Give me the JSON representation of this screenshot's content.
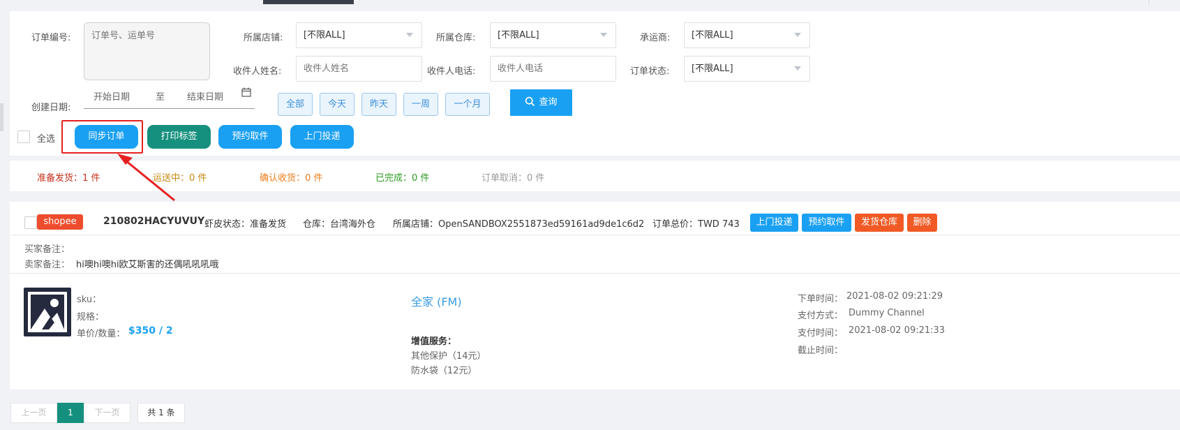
{
  "search": {
    "order_no_label": "订单编号:",
    "order_no_placeholder": "订单号、运单号",
    "shop_label": "所属店铺:",
    "shop_value": "[不限ALL]",
    "warehouse_label": "所属仓库:",
    "warehouse_value": "[不限ALL]",
    "carrier_label": "承运商:",
    "carrier_value": "[不限ALL]",
    "receiver_name_label": "收件人姓名:",
    "receiver_name_placeholder": "收件人姓名",
    "receiver_phone_label": "收件人电话:",
    "receiver_phone_placeholder": "收件人电话",
    "status_label": "订单状态:",
    "status_value": "[不限ALL]",
    "date_label": "创建日期:",
    "start_date": "开始日期",
    "to": "至",
    "end_date": "结束日期",
    "quick_ranges": [
      "全部",
      "今天",
      "昨天",
      "一周",
      "一个月"
    ],
    "search_button": "查询"
  },
  "actions": {
    "select_all": "全选",
    "sync": "同步订单",
    "print": "打印标签",
    "pickup": "预约取件",
    "dropoff": "上门投递"
  },
  "status": {
    "ready": "准备发货：1 件",
    "shipping": "运送中：0 件",
    "confirm": "确认收货：0 件",
    "done": "已完成：0 件",
    "cancel": "订单取消：0 件"
  },
  "order": {
    "platform": "shopee",
    "order_no": "210802HACYUVUY",
    "shopee_status": "虾皮状态：准备发货",
    "warehouse": "仓库：台湾海外仓",
    "shop": "所属店铺：OpenSANDBOX2551873ed59161ad9de1c6d2",
    "total": "订单总价：TWD 743",
    "buttons": [
      "上门投递",
      "预约取件",
      "发货仓库",
      "删除"
    ],
    "buyer_note_label": "买家备注：",
    "seller_note_label": "卖家备注：",
    "seller_note": "hi噢hi噢hi欧艾斯害的还偶吼吼吼哦",
    "sku_label": "sku：",
    "spec_label": "规格：",
    "price_label": "单价/数量：",
    "price": "$350 / 2",
    "carrier": "全家 (FM)",
    "vas_label": "增值服务：",
    "vas": [
      "其他保护（14元）",
      "防水袋（12元）"
    ],
    "order_time_label": "下单时间：",
    "order_time": "2021-08-02 09:21:29",
    "pay_method_label": "支付方式：",
    "pay_method": "Dummy Channel",
    "pay_time_label": "支付时间：",
    "pay_time": "2021-08-02 09:21:33",
    "deadline_label": "截止时间："
  },
  "pagination": {
    "prev": "上一页",
    "current": "1",
    "next": "下一页",
    "total": "共 1 条"
  },
  "colors": {
    "primary": "#1aa0f3",
    "teal": "#16907e",
    "shopee": "#ee4d2d",
    "danger": "#e62020"
  }
}
